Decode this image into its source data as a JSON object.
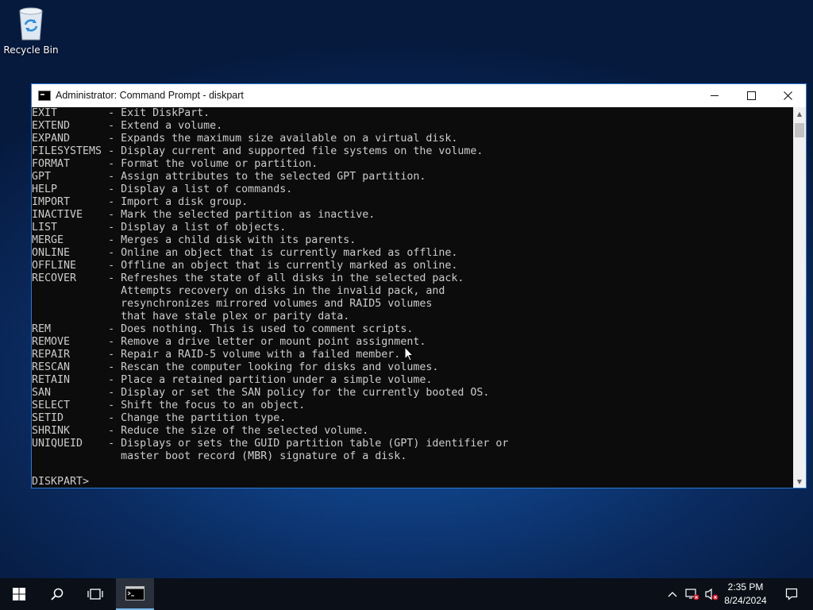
{
  "desktop": {
    "icons": [
      {
        "label": "Recycle Bin",
        "icon": "recycle-bin-icon"
      }
    ]
  },
  "window": {
    "title": "Administrator: Command Prompt - diskpart",
    "icon": "command-prompt-icon",
    "controls": {
      "minimize": "minimize-icon",
      "maximize": "maximize-icon",
      "close": "close-icon"
    },
    "console_text": "EXIT        - Exit DiskPart.\nEXTEND      - Extend a volume.\nEXPAND      - Expands the maximum size available on a virtual disk.\nFILESYSTEMS - Display current and supported file systems on the volume.\nFORMAT      - Format the volume or partition.\nGPT         - Assign attributes to the selected GPT partition.\nHELP        - Display a list of commands.\nIMPORT      - Import a disk group.\nINACTIVE    - Mark the selected partition as inactive.\nLIST        - Display a list of objects.\nMERGE       - Merges a child disk with its parents.\nONLINE      - Online an object that is currently marked as offline.\nOFFLINE     - Offline an object that is currently marked as online.\nRECOVER     - Refreshes the state of all disks in the selected pack.\n              Attempts recovery on disks in the invalid pack, and\n              resynchronizes mirrored volumes and RAID5 volumes\n              that have stale plex or parity data.\nREM         - Does nothing. This is used to comment scripts.\nREMOVE      - Remove a drive letter or mount point assignment.\nREPAIR      - Repair a RAID-5 volume with a failed member.\nRESCAN      - Rescan the computer looking for disks and volumes.\nRETAIN      - Place a retained partition under a simple volume.\nSAN         - Display or set the SAN policy for the currently booted OS.\nSELECT      - Shift the focus to an object.\nSETID       - Change the partition type.\nSHRINK      - Reduce the size of the selected volume.\nUNIQUEID    - Displays or sets the GUID partition table (GPT) identifier or\n              master boot record (MBR) signature of a disk.\n\nDISKPART>"
  },
  "taskbar": {
    "start_icon": "windows-start-icon",
    "search_icon": "search-icon",
    "task_view_icon": "task-view-icon",
    "pinned": [
      {
        "name": "command-prompt-icon",
        "active": true
      }
    ],
    "tray": {
      "icons": [
        "chevron-up-icon",
        "network-disconnected-icon",
        "volume-muted-icon"
      ],
      "time": "2:35 PM",
      "date": "8/24/2024",
      "notification_icon": "action-center-icon"
    }
  },
  "colors": {
    "console_bg": "#0c0c0c",
    "console_fg": "#cccccc",
    "accent": "#76b9ed",
    "tray_alert": "#e81123"
  }
}
